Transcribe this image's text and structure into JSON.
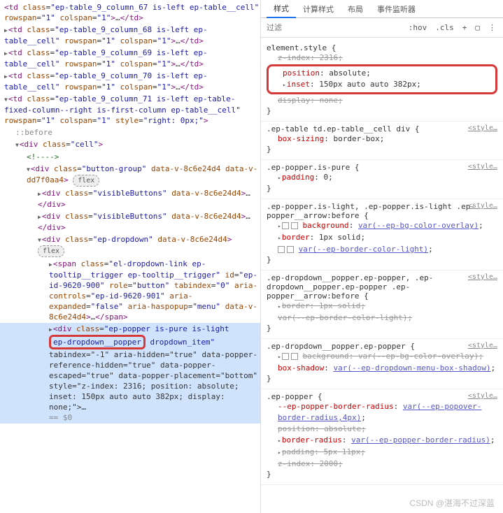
{
  "dom": {
    "line_partial": {
      "tag_fragment": "td",
      "class_fragment": "ep-table_9_column_67 is-left ep-ta",
      "rest": "ble__cell\" rowspan=\"1\" colspan=\"1\">…</td>"
    },
    "tds": [
      {
        "cls": "ep-table_9_column_68 is-left ep-table__cell",
        "rowspan": "1",
        "colspan": "1"
      },
      {
        "cls": "ep-table_9_column_69 is-left ep-table__cell",
        "rowspan": "1",
        "colspan": "1"
      },
      {
        "cls": "ep-table_9_column_70 is-left ep-table__cell",
        "rowspan": "1",
        "colspan": "1"
      }
    ],
    "td_fixed": {
      "cls": "ep-table_9_column_71 is-left ep-table-fixed-column--right is-first-column ep-table__cell",
      "rowspan": "1",
      "colspan": "1",
      "style": "right: 0px;"
    },
    "before": "::before",
    "cell_div": "<div class=\"cell\">",
    "comment": "<!---->",
    "button_group": {
      "cls": "button-group",
      "dv1": "data-v-8c6e24d4",
      "dv2": "data-v-dd7f0aa4"
    },
    "flex_badge": "flex",
    "visible_btn": {
      "cls": "visibleButtons",
      "dv": "data-v-8c6e24d4"
    },
    "dropdown": {
      "cls": "ep-dropdown",
      "dv": "data-v-8c6e24d4"
    },
    "dropdown_link": {
      "cls": "el-dropdown-link ep-tooltip__trigger ep-tooltip__trigger",
      "id": "ep-id-9620-900",
      "role": "button",
      "tabindex": "0",
      "aria_controls": "ep-id-9620-901",
      "aria_expanded": "false",
      "aria_haspopup": "menu",
      "dv": "data-v-8c6e24d4"
    },
    "popper": {
      "cls_line1": "ep-popper is-pure is-light",
      "cls_highlight": "ep-dropdown__popper",
      "cls_after": " dropdown_item\"",
      "rest": "tabindex=\"-1\" aria-hidden=\"true\" data-popper-reference-hidden=\"true\" data-popper-escaped=\"true\" data-popper-placement=\"bottom\" style=\"z-index: 2316; position: absolute; inset: 150px auto auto 382px; display: none;\">…"
    },
    "eq0": "== $0"
  },
  "tabs": [
    "样式",
    "计算样式",
    "布局",
    "事件监听器"
  ],
  "toolbar": {
    "filter_placeholder": "过滤",
    "hov": ":hov",
    "cls": ".cls",
    "plus": "+"
  },
  "rules": [
    {
      "selector": "element.style",
      "source": "",
      "decls": [
        {
          "prop": "z-index",
          "val": "2316",
          "strike": true,
          "boxed": false
        },
        {
          "prop": "position",
          "val": "absolute",
          "boxed": true
        },
        {
          "prop": "inset",
          "val": "150px auto auto 382px",
          "boxed": true,
          "tri": true
        },
        {
          "prop": "display",
          "val": "none",
          "strike": true
        }
      ]
    },
    {
      "selector": ".ep-table td.ep-table__cell div",
      "source": "<style…",
      "decls": [
        {
          "prop": "box-sizing",
          "val": "border-box"
        }
      ]
    },
    {
      "selector": ".ep-popper.is-pure",
      "source": "<style…",
      "decls": [
        {
          "prop": "padding",
          "val": "0",
          "tri": true
        }
      ]
    },
    {
      "selector": ".ep-popper.is-light, .ep-popper.is-light .ep-popper__arrow:before",
      "source": "<style…",
      "decls": [
        {
          "prop": "background",
          "val": "var(--ep-bg-color-overlay)",
          "swatch": true,
          "tri": true,
          "link": true
        },
        {
          "prop": "border",
          "val": "1px solid",
          "tri": true
        },
        {
          "prop": "",
          "val": "var(--ep-border-color-light)",
          "swatch": true,
          "link": true
        }
      ]
    },
    {
      "selector": ".ep-dropdown__popper.ep-popper, .ep-dropdown__popper.ep-popper .ep-popper__arrow:before",
      "source": "<style…",
      "decls": [
        {
          "prop": "border",
          "val": "1px solid",
          "strike": true,
          "tri": true
        },
        {
          "prop": "",
          "val": "var(--ep-border-color-light)",
          "strike": true,
          "link": true
        }
      ]
    },
    {
      "selector": ".ep-dropdown__popper.ep-popper",
      "source": "<style…",
      "decls": [
        {
          "prop": "background",
          "val": "var(--ep-bg-color-overlay)",
          "strike": true,
          "swatch": true,
          "tri": true,
          "link": true
        },
        {
          "prop": "box-shadow",
          "val": "var(--ep-dropdown-menu-box-shadow)",
          "link": true
        }
      ]
    },
    {
      "selector": ".ep-popper",
      "source": "<style…",
      "decls": [
        {
          "prop": "--ep-popper-border-radius",
          "val": "var(--ep-popover-border-radius,4px)",
          "link": true
        },
        {
          "prop": "position",
          "val": "absolute",
          "strike": true
        },
        {
          "prop": "border-radius",
          "val": "var(--ep-popper-border-radius)",
          "tri": true,
          "link": true
        },
        {
          "prop": "padding",
          "val": "5px 11px",
          "strike": true,
          "tri": true
        },
        {
          "prop": "z-index",
          "val": "2000",
          "strike": true
        }
      ]
    }
  ],
  "watermark": "CSDN @湛海不过深蓝"
}
